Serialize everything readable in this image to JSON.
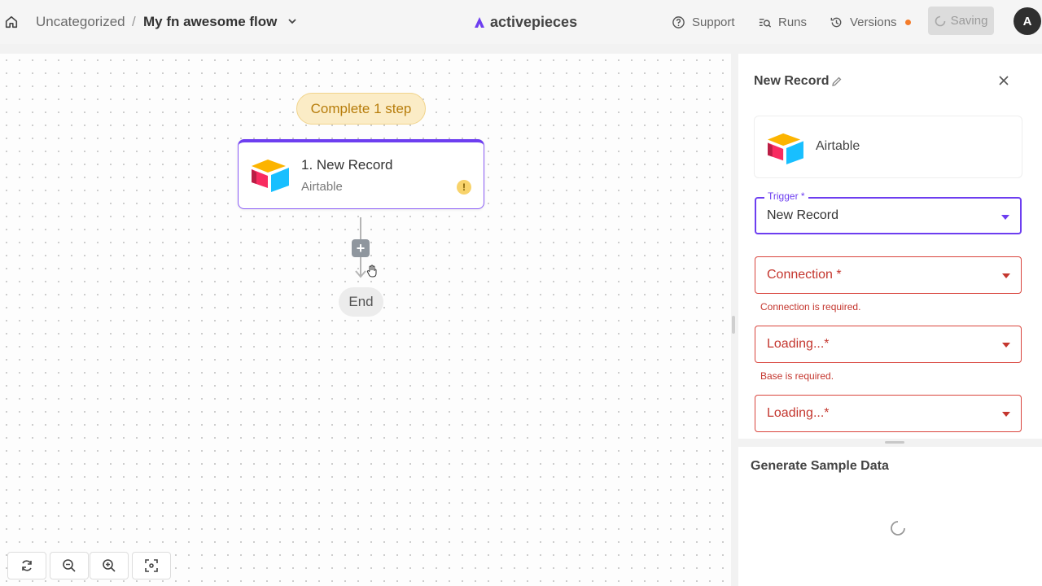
{
  "header": {
    "breadcrumb_folder": "Uncategorized",
    "breadcrumb_separator": "/",
    "flow_name": "My fn awesome flow",
    "logo_text": "activepieces",
    "support_label": "Support",
    "runs_label": "Runs",
    "versions_label": "Versions",
    "saving_label": "Saving",
    "avatar_initial": "A",
    "icons": [
      "home-icon",
      "chevron-down-icon",
      "help-circle-icon",
      "runs-list-icon",
      "history-icon",
      "spinner-icon"
    ]
  },
  "canvas": {
    "status_badge": "Complete 1 step",
    "step": {
      "title": "1. New Record",
      "subtitle": "Airtable",
      "warning_glyph": "!"
    },
    "add_button_glyph": "+",
    "end_label": "End",
    "controls": [
      "refresh-icon",
      "zoom-out-icon",
      "zoom-in-icon",
      "fit-view-icon"
    ]
  },
  "panel": {
    "title": "New Record",
    "piece_name": "Airtable",
    "trigger": {
      "legend": "Trigger *",
      "value": "New Record"
    },
    "connection": {
      "value": "Connection *",
      "error": "Connection is required."
    },
    "base": {
      "value": "Loading...*",
      "error": "Base is required."
    },
    "table": {
      "value": "Loading...*"
    }
  },
  "sample_data": {
    "title": "Generate Sample Data"
  },
  "colors": {
    "accent": "#6d3ef0",
    "error": "#c4362e",
    "badge_bg": "#fbecc6",
    "badge_text": "#b77d0c",
    "dot": "#f47c2a"
  }
}
